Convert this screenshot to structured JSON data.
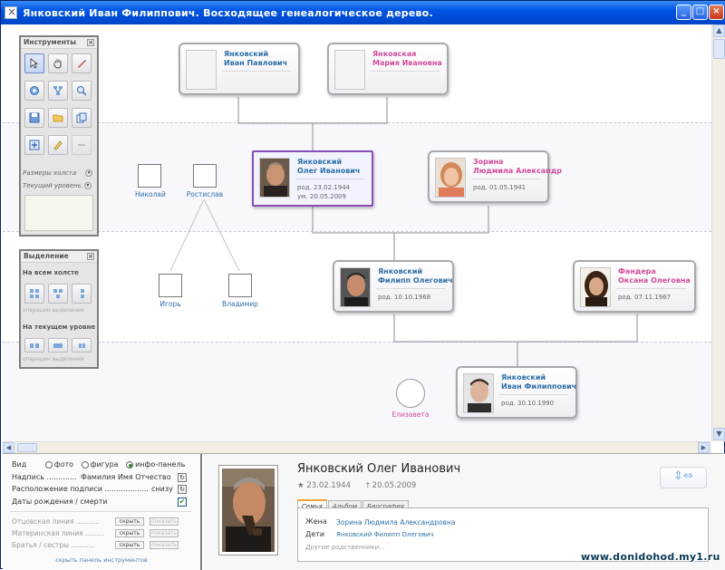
{
  "window": {
    "title": "Янковский Иван Филиппович. Восходящее генеалогическое дерево."
  },
  "colors": {
    "male": "#2f6fa6",
    "female": "#d24c9b",
    "selected": "#8a4db8"
  },
  "tree": {
    "cards": [
      {
        "id": "ivan-pavlovich",
        "name1": "Янковский",
        "name2": "Иван Павлович",
        "gender": "male",
        "dates": [
          "",
          ""
        ],
        "photo": "empty"
      },
      {
        "id": "mariya-ivanovna",
        "name1": "Янковская",
        "name2": "Мария Ивановна",
        "gender": "female",
        "dates": [
          "",
          ""
        ],
        "photo": "empty"
      },
      {
        "id": "oleg-ivanovich",
        "name1": "Янковский",
        "name2": "Олег Иванович",
        "gender": "male",
        "dates": [
          "род.  23.02.1944",
          "ум.   20.05.2009"
        ],
        "photo": "old-man",
        "selected": true
      },
      {
        "id": "lyudmila",
        "name1": "Зорина",
        "name2": "Людмила Алексаnдр",
        "gender": "female",
        "dates": [
          "род.  01.05.1941",
          ""
        ],
        "photo": "woman"
      },
      {
        "id": "filipp-olegovich",
        "name1": "Янковский",
        "name2": "Филипп Олегович",
        "gender": "male",
        "dates": [
          "род.  10.10.1968",
          ""
        ],
        "photo": "man"
      },
      {
        "id": "oksana",
        "name1": "Фандера",
        "name2": "Оксана Олеговна",
        "gender": "female",
        "dates": [
          "род.  07.11.1967",
          ""
        ],
        "photo": "dark-woman"
      },
      {
        "id": "ivan-filippovich",
        "name1": "Янковский",
        "name2": "Иван Филиппович",
        "gender": "male",
        "dates": [
          "род.  30.10.1990",
          ""
        ],
        "photo": "young"
      }
    ],
    "mini": [
      {
        "id": "nikolai",
        "label": "Николай",
        "gender": "male"
      },
      {
        "id": "rostislav",
        "label": "Ростислав",
        "gender": "male"
      },
      {
        "id": "igor",
        "label": "Игорь",
        "gender": "male"
      },
      {
        "id": "vladimir",
        "label": "Владимир",
        "gender": "male"
      },
      {
        "id": "elizaveta",
        "label": "Елизавета",
        "gender": "female"
      }
    ]
  },
  "tools_panel": {
    "title": "Инструменты",
    "tools": [
      "pointer-icon",
      "hand-icon",
      "pen-icon",
      "settings-icon",
      "tree-layout-icon",
      "zoom-icon",
      "save-icon",
      "open-folder-icon",
      "copy-icon",
      "add-person-icon",
      "edit-icon",
      "delete-icon"
    ],
    "canvas_size": "Размеры холста",
    "current_level": "Текущий уровень"
  },
  "selection_panel": {
    "title": "Выделение",
    "all_canvas": "На всем холсте",
    "current_level": "На текущем уровне",
    "sub1": "операции выделения",
    "sub2": "операции выделения"
  },
  "settings": {
    "view_label": "Вид",
    "view_options": [
      "фото",
      "фигура",
      "инфо-панель"
    ],
    "caption_label": "Надпись .............",
    "caption_value": "Фамилия Имя Отчество",
    "caption_pos_label": "Расположение подписи ...................",
    "caption_pos_value": "снизу",
    "dates_label": "Даты рождения / смерти",
    "lines": [
      {
        "label": "Отцовская линия ...........",
        "btn1": "скрыть",
        "btn2": "показать"
      },
      {
        "label": "Материнская линия .........",
        "btn1": "скрыть",
        "btn2": "показать"
      },
      {
        "label": "Братья / сестры ...........",
        "btn1": "скрыть",
        "btn2": "показать"
      }
    ],
    "hide_panel": "скрыть панель инструментов"
  },
  "info": {
    "name": "Янковский Олег Иванович",
    "birth": "23.02.1944",
    "death": "20.05.2009",
    "tabs": [
      "Семья",
      "Альбом",
      "Биография"
    ],
    "wife_label": "Жена",
    "wife_value": "Зорина Людмила Александровна",
    "kids_label": "Дети",
    "kids_value": "Янковский Филипп Олегович",
    "other": "Другие родственники..."
  },
  "watermark": "www.donidohod.my1.ru"
}
